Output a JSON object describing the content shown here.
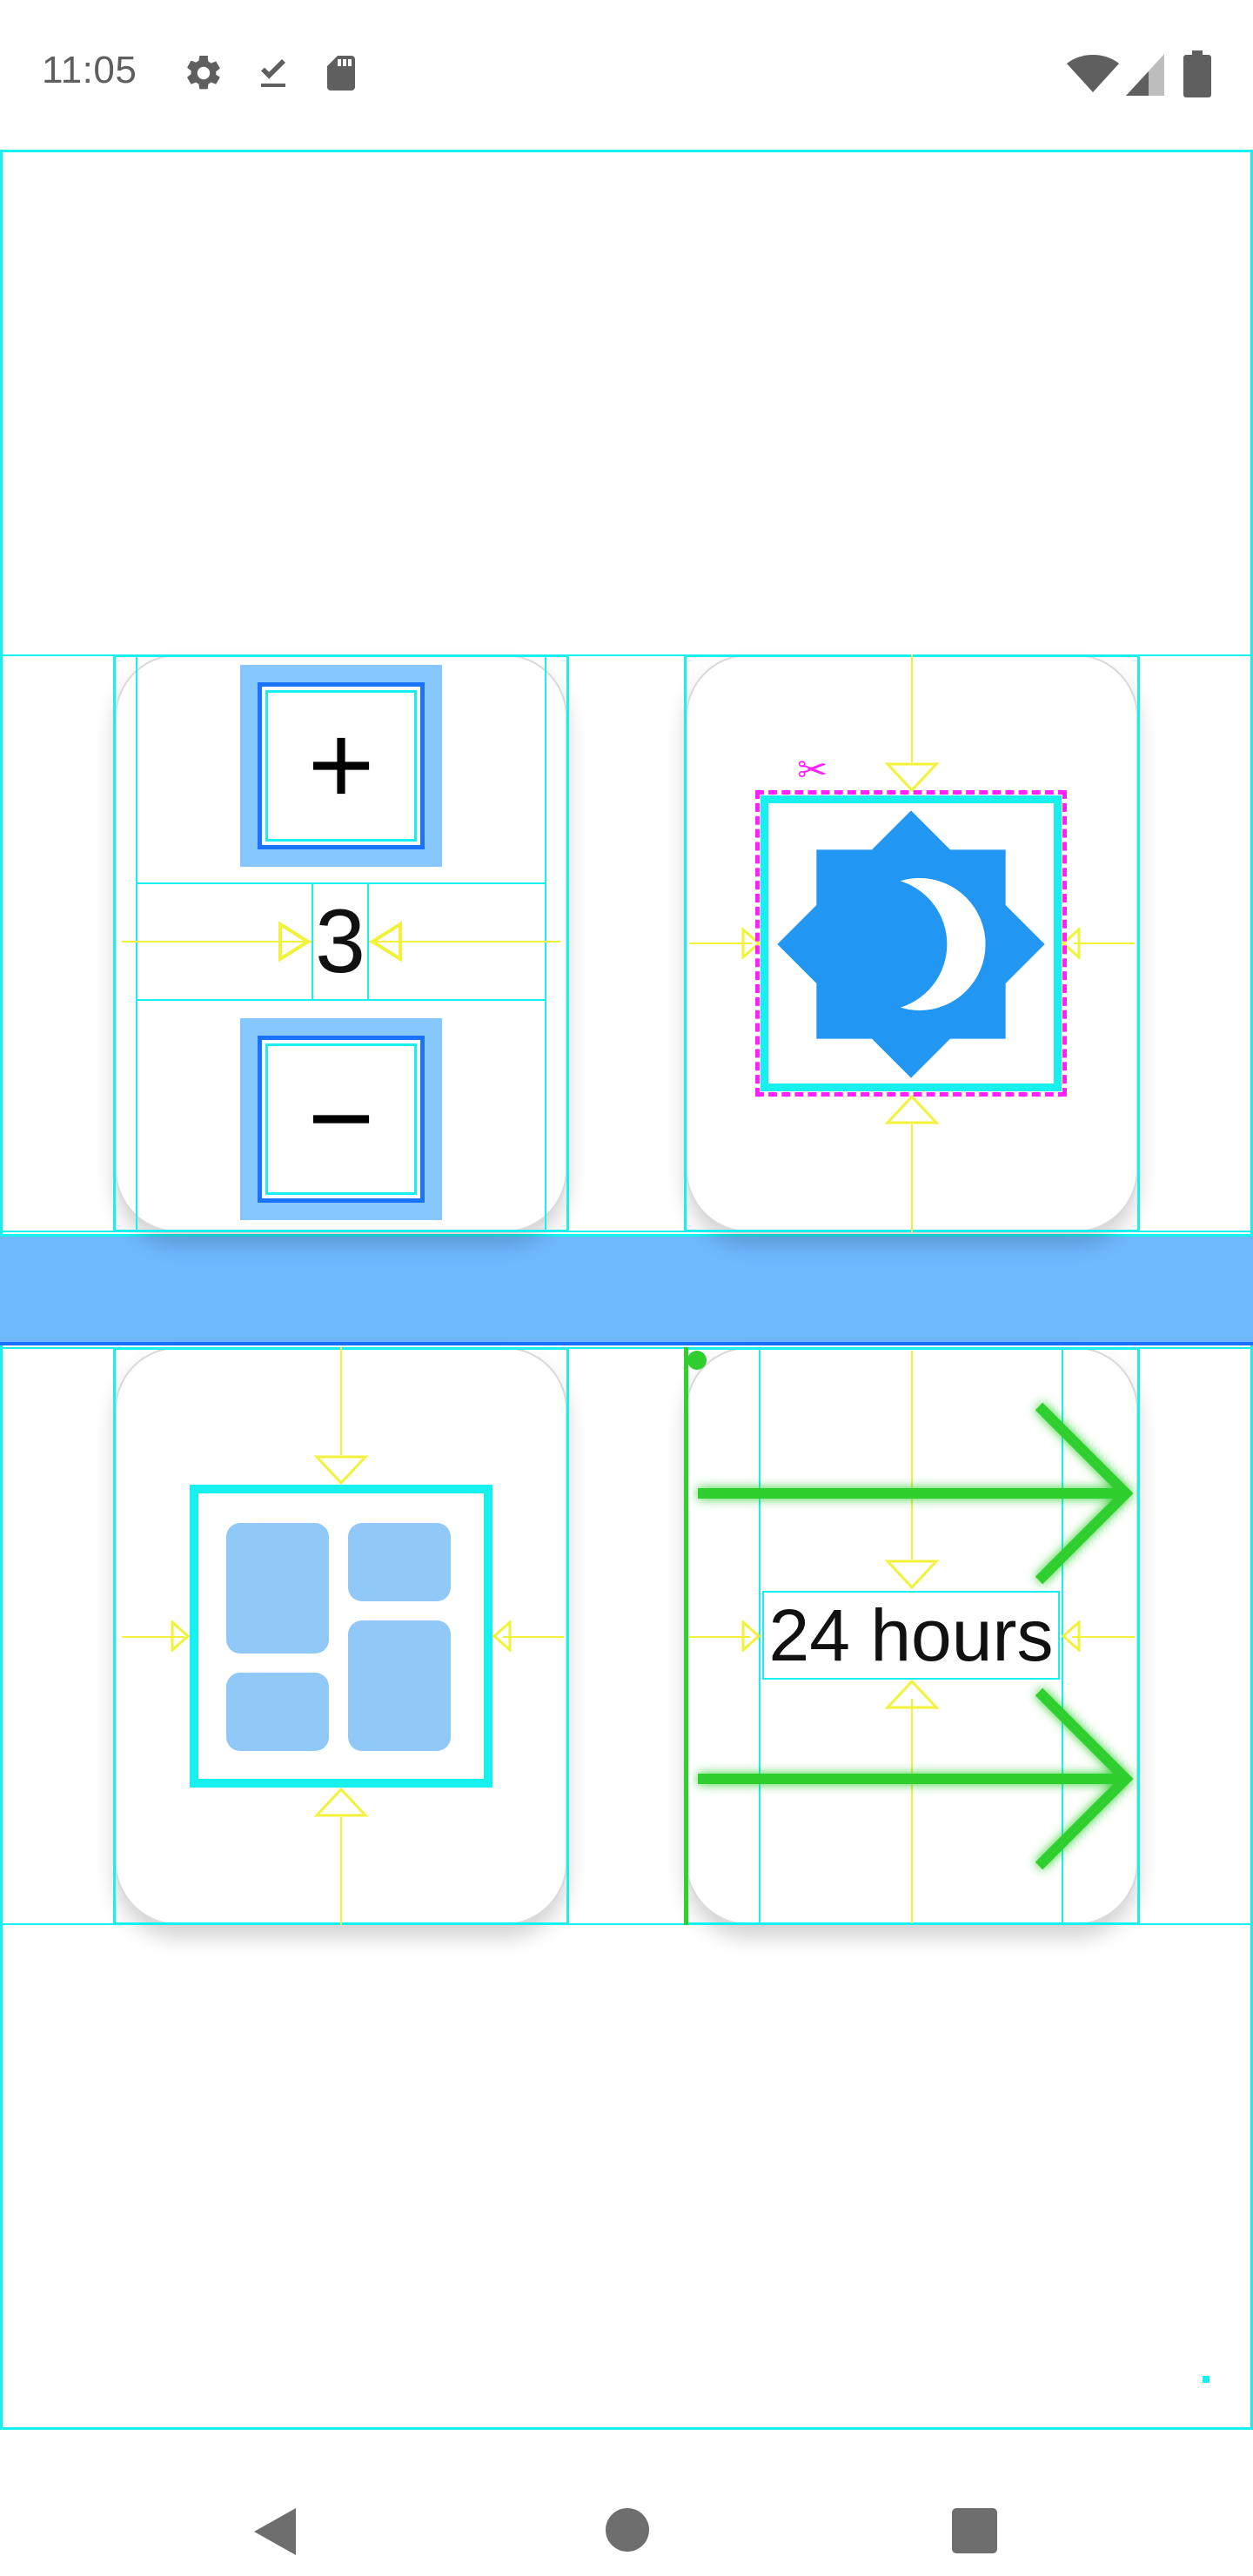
{
  "status_bar": {
    "time": "11:05",
    "left_icons": [
      "settings-icon",
      "download-done-icon",
      "sd-card-icon"
    ],
    "right_icons": [
      "wifi-icon",
      "cell-signal-icon",
      "battery-icon"
    ]
  },
  "tiles": {
    "counter": {
      "value": "3",
      "icons": [
        "plus-icon",
        "minus-icon"
      ]
    },
    "brightness": {
      "icon": "brightness-auto-icon"
    },
    "dashboard": {
      "icon": "dashboard-icon"
    },
    "duration": {
      "label": "24 hours"
    }
  },
  "debug_colors": {
    "layout_bounds": "#18f0f0",
    "margin_guides": "#f2f23a",
    "clip_bounds": "#ff22ff",
    "touch_targets": "#2fcf2f",
    "separator_bar": "#6fb8ff"
  },
  "nav_bar": {
    "icons": [
      "back-icon",
      "home-icon",
      "recents-icon"
    ]
  }
}
